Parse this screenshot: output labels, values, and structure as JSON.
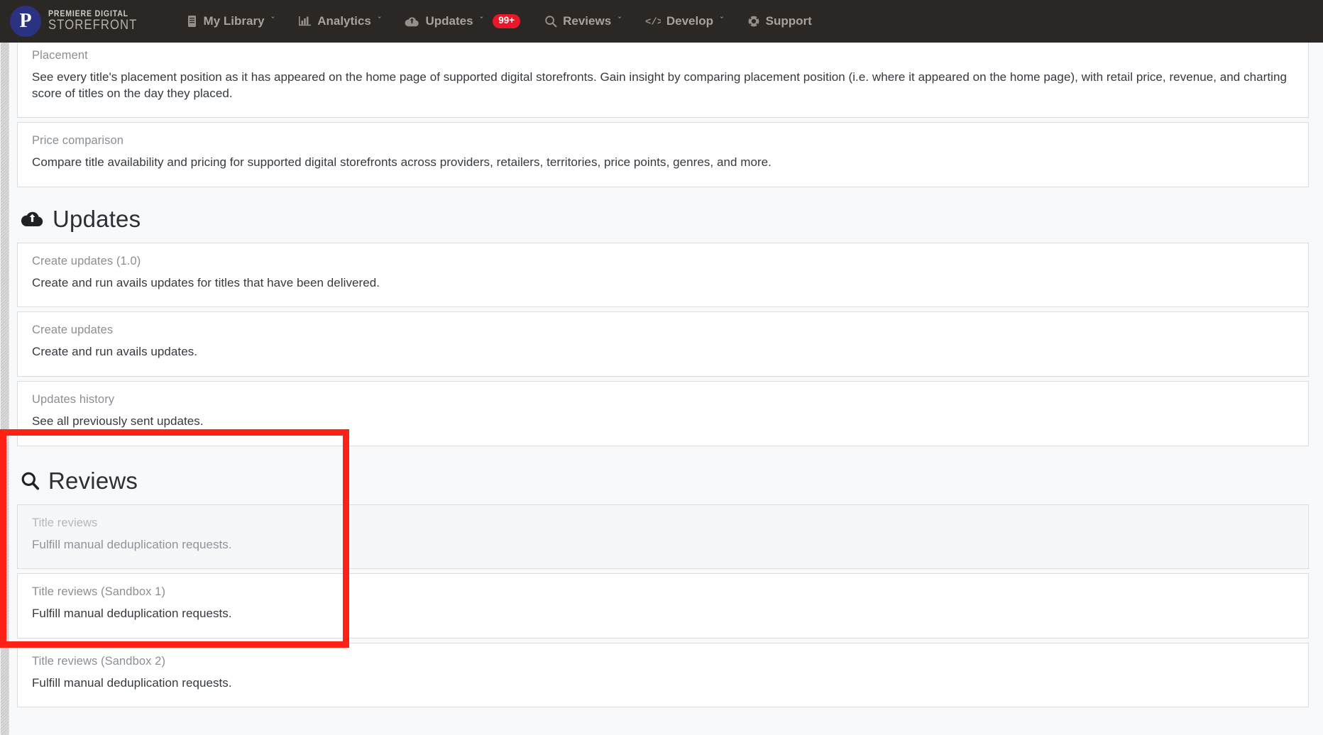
{
  "navbar": {
    "brand": {
      "monogram": "P",
      "line1": "PREMIERE DIGITAL",
      "line2": "STOREFRONT"
    },
    "items": [
      {
        "label": "My Library",
        "icon": "book-icon",
        "caret": "ˇ",
        "badge": null
      },
      {
        "label": "Analytics",
        "icon": "chart-icon",
        "caret": "ˇ",
        "badge": null
      },
      {
        "label": "Updates",
        "icon": "cloud-upload-icon",
        "caret": "ˇ",
        "badge": "99+"
      },
      {
        "label": "Reviews",
        "icon": "search-icon",
        "caret": "ˇ",
        "badge": null
      },
      {
        "label": "Develop",
        "icon": "code-icon",
        "caret": "ˇ",
        "badge": null
      },
      {
        "label": "Support",
        "icon": "life-ring-icon",
        "caret": "",
        "badge": null
      }
    ],
    "badge_color": "#e8172a",
    "background_color": "#2b2724"
  },
  "analytics_cards": [
    {
      "title": "Placement",
      "desc": "See every title's placement position as it has appeared on the home page of supported digital storefronts. Gain insight by comparing placement position (i.e. where it appeared on the home page), with retail price, revenue, and charting score of titles on the day they placed."
    },
    {
      "title": "Price comparison",
      "desc": "Compare title availability and pricing for supported digital storefronts across providers, retailers, territories, price points, genres, and more."
    }
  ],
  "updates_section": {
    "heading": "Updates",
    "heading_icon": "cloud-upload-icon",
    "cards": [
      {
        "title": "Create updates (1.0)",
        "desc": "Create and run avails updates for titles that have been delivered."
      },
      {
        "title": "Create updates",
        "desc": "Create and run avails updates."
      },
      {
        "title": "Updates history",
        "desc": "See all previously sent updates."
      }
    ]
  },
  "reviews_section": {
    "heading": "Reviews",
    "heading_icon": "search-icon",
    "cards": [
      {
        "title": "Title reviews",
        "desc": "Fulfill manual deduplication requests.",
        "state": "muted"
      },
      {
        "title": "Title reviews (Sandbox 1)",
        "desc": "Fulfill manual deduplication requests.",
        "state": "normal"
      },
      {
        "title": "Title reviews (Sandbox 2)",
        "desc": "Fulfill manual deduplication requests.",
        "state": "normal"
      }
    ]
  },
  "annotation": {
    "color": "#ff2016",
    "target": "reviews-section"
  }
}
